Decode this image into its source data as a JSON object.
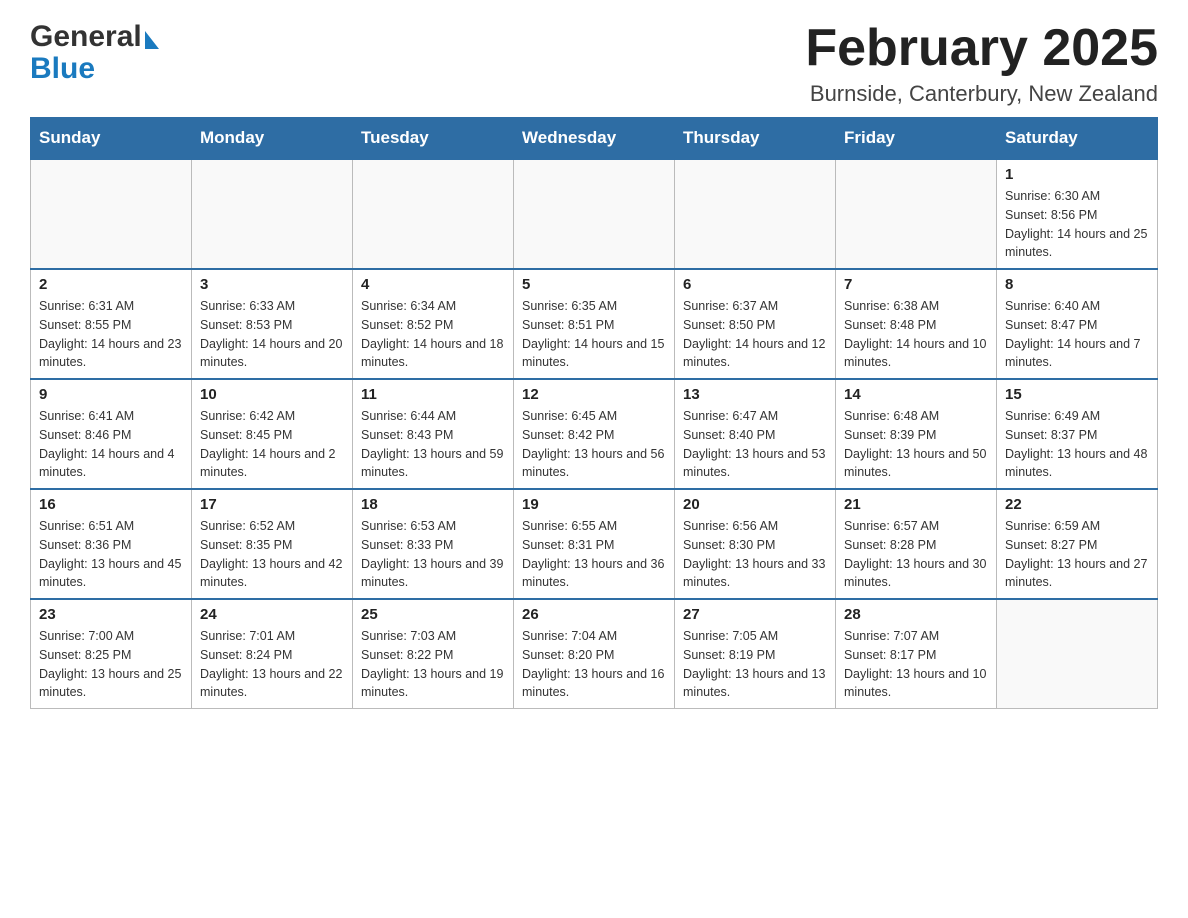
{
  "header": {
    "month_title": "February 2025",
    "location": "Burnside, Canterbury, New Zealand",
    "logo_general": "General",
    "logo_blue": "Blue"
  },
  "weekdays": [
    "Sunday",
    "Monday",
    "Tuesday",
    "Wednesday",
    "Thursday",
    "Friday",
    "Saturday"
  ],
  "weeks": [
    [
      {
        "day": "",
        "sunrise": "",
        "sunset": "",
        "daylight": ""
      },
      {
        "day": "",
        "sunrise": "",
        "sunset": "",
        "daylight": ""
      },
      {
        "day": "",
        "sunrise": "",
        "sunset": "",
        "daylight": ""
      },
      {
        "day": "",
        "sunrise": "",
        "sunset": "",
        "daylight": ""
      },
      {
        "day": "",
        "sunrise": "",
        "sunset": "",
        "daylight": ""
      },
      {
        "day": "",
        "sunrise": "",
        "sunset": "",
        "daylight": ""
      },
      {
        "day": "1",
        "sunrise": "Sunrise: 6:30 AM",
        "sunset": "Sunset: 8:56 PM",
        "daylight": "Daylight: 14 hours and 25 minutes."
      }
    ],
    [
      {
        "day": "2",
        "sunrise": "Sunrise: 6:31 AM",
        "sunset": "Sunset: 8:55 PM",
        "daylight": "Daylight: 14 hours and 23 minutes."
      },
      {
        "day": "3",
        "sunrise": "Sunrise: 6:33 AM",
        "sunset": "Sunset: 8:53 PM",
        "daylight": "Daylight: 14 hours and 20 minutes."
      },
      {
        "day": "4",
        "sunrise": "Sunrise: 6:34 AM",
        "sunset": "Sunset: 8:52 PM",
        "daylight": "Daylight: 14 hours and 18 minutes."
      },
      {
        "day": "5",
        "sunrise": "Sunrise: 6:35 AM",
        "sunset": "Sunset: 8:51 PM",
        "daylight": "Daylight: 14 hours and 15 minutes."
      },
      {
        "day": "6",
        "sunrise": "Sunrise: 6:37 AM",
        "sunset": "Sunset: 8:50 PM",
        "daylight": "Daylight: 14 hours and 12 minutes."
      },
      {
        "day": "7",
        "sunrise": "Sunrise: 6:38 AM",
        "sunset": "Sunset: 8:48 PM",
        "daylight": "Daylight: 14 hours and 10 minutes."
      },
      {
        "day": "8",
        "sunrise": "Sunrise: 6:40 AM",
        "sunset": "Sunset: 8:47 PM",
        "daylight": "Daylight: 14 hours and 7 minutes."
      }
    ],
    [
      {
        "day": "9",
        "sunrise": "Sunrise: 6:41 AM",
        "sunset": "Sunset: 8:46 PM",
        "daylight": "Daylight: 14 hours and 4 minutes."
      },
      {
        "day": "10",
        "sunrise": "Sunrise: 6:42 AM",
        "sunset": "Sunset: 8:45 PM",
        "daylight": "Daylight: 14 hours and 2 minutes."
      },
      {
        "day": "11",
        "sunrise": "Sunrise: 6:44 AM",
        "sunset": "Sunset: 8:43 PM",
        "daylight": "Daylight: 13 hours and 59 minutes."
      },
      {
        "day": "12",
        "sunrise": "Sunrise: 6:45 AM",
        "sunset": "Sunset: 8:42 PM",
        "daylight": "Daylight: 13 hours and 56 minutes."
      },
      {
        "day": "13",
        "sunrise": "Sunrise: 6:47 AM",
        "sunset": "Sunset: 8:40 PM",
        "daylight": "Daylight: 13 hours and 53 minutes."
      },
      {
        "day": "14",
        "sunrise": "Sunrise: 6:48 AM",
        "sunset": "Sunset: 8:39 PM",
        "daylight": "Daylight: 13 hours and 50 minutes."
      },
      {
        "day": "15",
        "sunrise": "Sunrise: 6:49 AM",
        "sunset": "Sunset: 8:37 PM",
        "daylight": "Daylight: 13 hours and 48 minutes."
      }
    ],
    [
      {
        "day": "16",
        "sunrise": "Sunrise: 6:51 AM",
        "sunset": "Sunset: 8:36 PM",
        "daylight": "Daylight: 13 hours and 45 minutes."
      },
      {
        "day": "17",
        "sunrise": "Sunrise: 6:52 AM",
        "sunset": "Sunset: 8:35 PM",
        "daylight": "Daylight: 13 hours and 42 minutes."
      },
      {
        "day": "18",
        "sunrise": "Sunrise: 6:53 AM",
        "sunset": "Sunset: 8:33 PM",
        "daylight": "Daylight: 13 hours and 39 minutes."
      },
      {
        "day": "19",
        "sunrise": "Sunrise: 6:55 AM",
        "sunset": "Sunset: 8:31 PM",
        "daylight": "Daylight: 13 hours and 36 minutes."
      },
      {
        "day": "20",
        "sunrise": "Sunrise: 6:56 AM",
        "sunset": "Sunset: 8:30 PM",
        "daylight": "Daylight: 13 hours and 33 minutes."
      },
      {
        "day": "21",
        "sunrise": "Sunrise: 6:57 AM",
        "sunset": "Sunset: 8:28 PM",
        "daylight": "Daylight: 13 hours and 30 minutes."
      },
      {
        "day": "22",
        "sunrise": "Sunrise: 6:59 AM",
        "sunset": "Sunset: 8:27 PM",
        "daylight": "Daylight: 13 hours and 27 minutes."
      }
    ],
    [
      {
        "day": "23",
        "sunrise": "Sunrise: 7:00 AM",
        "sunset": "Sunset: 8:25 PM",
        "daylight": "Daylight: 13 hours and 25 minutes."
      },
      {
        "day": "24",
        "sunrise": "Sunrise: 7:01 AM",
        "sunset": "Sunset: 8:24 PM",
        "daylight": "Daylight: 13 hours and 22 minutes."
      },
      {
        "day": "25",
        "sunrise": "Sunrise: 7:03 AM",
        "sunset": "Sunset: 8:22 PM",
        "daylight": "Daylight: 13 hours and 19 minutes."
      },
      {
        "day": "26",
        "sunrise": "Sunrise: 7:04 AM",
        "sunset": "Sunset: 8:20 PM",
        "daylight": "Daylight: 13 hours and 16 minutes."
      },
      {
        "day": "27",
        "sunrise": "Sunrise: 7:05 AM",
        "sunset": "Sunset: 8:19 PM",
        "daylight": "Daylight: 13 hours and 13 minutes."
      },
      {
        "day": "28",
        "sunrise": "Sunrise: 7:07 AM",
        "sunset": "Sunset: 8:17 PM",
        "daylight": "Daylight: 13 hours and 10 minutes."
      },
      {
        "day": "",
        "sunrise": "",
        "sunset": "",
        "daylight": ""
      }
    ]
  ]
}
